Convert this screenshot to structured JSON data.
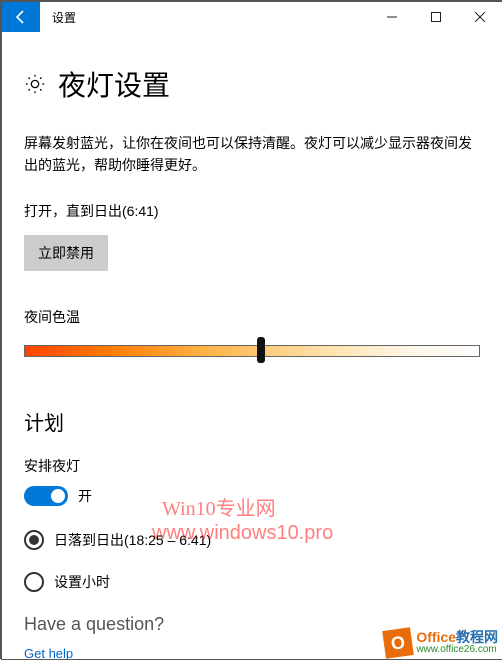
{
  "titlebar": {
    "title": "设置"
  },
  "page": {
    "heading": "夜灯设置",
    "description": "屏幕发射蓝光，让你在夜间也可以保持清醒。夜灯可以减少显示器夜间发出的蓝光，帮助你睡得更好。",
    "status": "打开，直到日出(6:41)",
    "disable_now": "立即禁用",
    "color_temp_label": "夜间色温",
    "slider_percent": 52
  },
  "schedule": {
    "heading": "计划",
    "label": "安排夜灯",
    "toggle_label": "开",
    "toggle_on": true,
    "option_sunset": "日落到日出(18:25 – 6:41)",
    "option_hours": "设置小时",
    "selected": "sunset"
  },
  "footer": {
    "heading": "Have a question?",
    "link": "Get help"
  },
  "watermark": {
    "line1": "Win10专业网",
    "line2": "www.windows10.pro"
  },
  "corner": {
    "badge": "O",
    "brand1a": "Office",
    "brand1b": "教程网",
    "url": "www.office26.com"
  }
}
